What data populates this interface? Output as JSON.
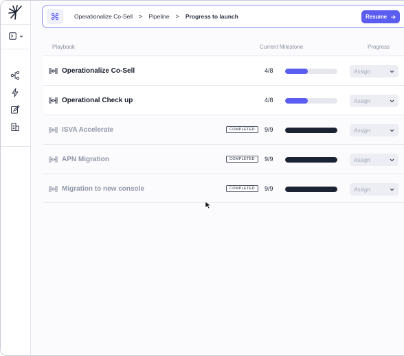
{
  "breadcrumb": [
    "Operationalize Co-Sell",
    "Pipeline",
    "Progress to launch"
  ],
  "breadcrumb_separator": ">",
  "resume_label": "Resume",
  "columns": {
    "playbook": "Playbook",
    "milestone": "Current Milestone",
    "progress": "Progress"
  },
  "rows": [
    {
      "title": "Operationalize Co-Sell",
      "count": "4/8",
      "progress": 0.43,
      "completed": false,
      "badge": "",
      "assign": "Assign"
    },
    {
      "title": "Operational Check up",
      "count": "4/8",
      "progress": 0.43,
      "completed": false,
      "badge": "",
      "assign": "Assign"
    },
    {
      "title": "ISVA Accelerate",
      "count": "9/9",
      "progress": 1.0,
      "completed": true,
      "badge": "COMPLETED",
      "assign": "Assign"
    },
    {
      "title": "APN Migration",
      "count": "9/9",
      "progress": 1.0,
      "completed": true,
      "badge": "COMPLETED",
      "assign": "Assign"
    },
    {
      "title": "Migration to new console",
      "count": "9/9",
      "progress": 1.0,
      "completed": true,
      "badge": "COMPLETED",
      "assign": "Assign"
    }
  ],
  "colors": {
    "accent": "#5b5cf0",
    "complete": "#1b2333",
    "track": "#e6e8ee"
  },
  "icons": {
    "sidebar": [
      "panel-icon",
      "workflow-icon",
      "lightning-icon",
      "edit-icon",
      "building-icon"
    ],
    "row": "playbook-icon"
  }
}
